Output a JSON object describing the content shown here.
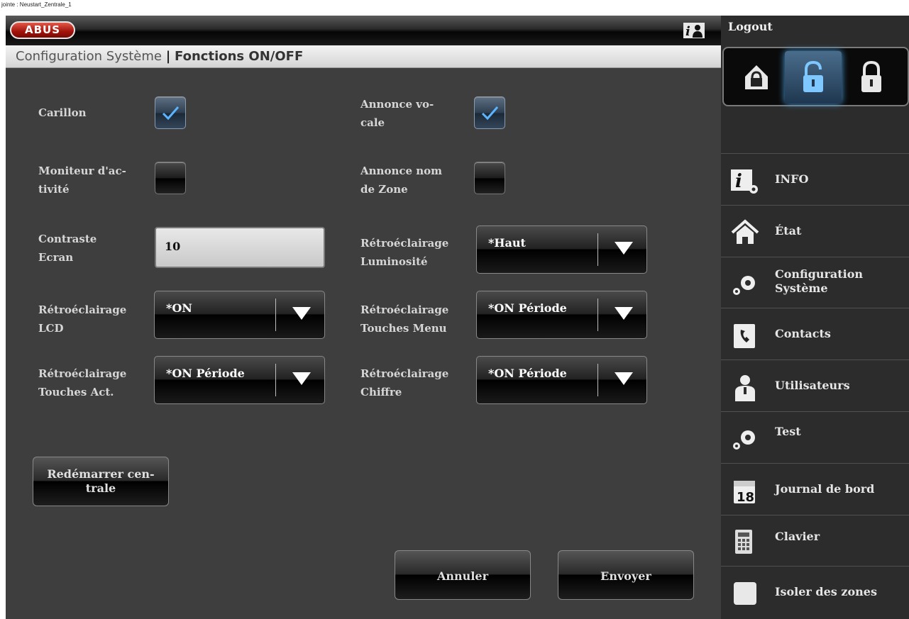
{
  "caption": "jointe : Neustart_Zentrale_1",
  "header": {
    "logo": "ABUS"
  },
  "breadcrumb": {
    "parent": "Configuration Système",
    "separator": "|",
    "current": "Fonctions ON/OFF"
  },
  "form": {
    "carillon": {
      "label": "Carillon",
      "checked": true
    },
    "annonce_vocale": {
      "label_1": "Annonce vo-",
      "label_2": "cale",
      "checked": true
    },
    "moniteur": {
      "label_1": "Moniteur d'ac-",
      "label_2": "tivité",
      "checked": false
    },
    "annonce_zone": {
      "label_1": "Annonce nom",
      "label_2": "de Zone",
      "checked": false
    },
    "contraste": {
      "label_1": "Contraste",
      "label_2": "Ecran",
      "value": "10"
    },
    "retro_lum": {
      "label_1": "Rétroéclairage",
      "label_2": "Luminosité",
      "value": "*Haut"
    },
    "retro_lcd": {
      "label_1": "Rétroéclairage",
      "label_2": "LCD",
      "value": "*ON"
    },
    "retro_menu": {
      "label_1": "Rétroéclairage",
      "label_2": "Touches Menu",
      "value": "*ON Période"
    },
    "retro_act": {
      "label_1": "Rétroéclairage",
      "label_2": "Touches Act.",
      "value": "*ON Période"
    },
    "retro_chiffre": {
      "label_1": "Rétroéclairage",
      "label_2": "Chiffre",
      "value": "*ON Période"
    }
  },
  "buttons": {
    "restart_1": "Redémarrer cen-",
    "restart_2": "trale",
    "cancel": "Annuler",
    "send": "Envoyer"
  },
  "sidebar": {
    "logout": "Logout",
    "items": [
      {
        "label": "INFO",
        "icon": "info-gear-icon"
      },
      {
        "label": "État",
        "icon": "home-icon"
      },
      {
        "label_1": "Configuration",
        "label_2": "Système",
        "icon": "gears-icon"
      },
      {
        "label": "Contacts",
        "icon": "phonebook-icon"
      },
      {
        "label": "Utilisateurs",
        "icon": "user-icon"
      },
      {
        "label": "Test",
        "icon": "gears-icon"
      },
      {
        "label": "Journal de bord",
        "icon": "calendar-icon",
        "day": "18"
      },
      {
        "label": "Clavier",
        "icon": "keypad-icon"
      },
      {
        "label": "Isoler des zones",
        "icon": "square-icon"
      }
    ]
  }
}
